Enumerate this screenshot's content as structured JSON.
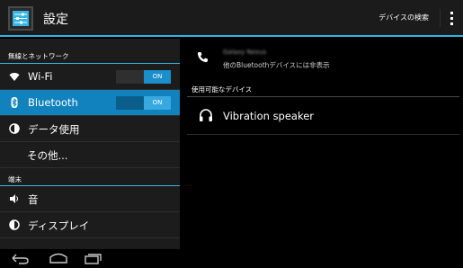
{
  "actionbar": {
    "title": "設定",
    "action_label": "デバイスの検索",
    "app_icon": "settings-sliders-icon",
    "overflow_icon": "overflow-menu-icon"
  },
  "left": {
    "section_wireless": "無線とネットワーク",
    "section_device": "端末",
    "items": [
      {
        "label": "Wi-Fi",
        "icon": "wifi-icon",
        "toggle": "ON"
      },
      {
        "label": "Bluetooth",
        "icon": "bluetooth-icon",
        "toggle": "ON"
      },
      {
        "label": "データ使用",
        "icon": "data-usage-icon"
      },
      {
        "label": "その他..."
      },
      {
        "label": "音",
        "icon": "sound-icon"
      },
      {
        "label": "ディスプレイ",
        "icon": "display-icon"
      }
    ]
  },
  "right": {
    "device_name": "Galaxy Nexus",
    "device_status": "他のBluetoothデバイスには非表示",
    "available_header": "使用可能なデバイス",
    "available_devices": [
      {
        "label": "Vibration speaker",
        "icon": "headphones-icon"
      }
    ]
  },
  "nav": [
    "back-icon",
    "home-icon",
    "recent-apps-icon"
  ],
  "colors": {
    "accent": "#33b5e5",
    "selected": "#1282be",
    "toggle_on": "#1a8fcb"
  }
}
